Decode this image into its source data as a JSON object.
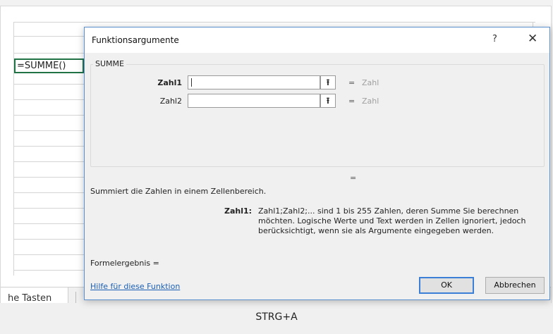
{
  "spreadsheet": {
    "active_cell_formula": "=SUMME()",
    "sheet_tab_label": "he Tasten"
  },
  "dialog": {
    "title": "Funktionsargumente",
    "help_button": "?",
    "close_button": "✕",
    "function_name": "SUMME",
    "arguments": [
      {
        "label": "Zahl1",
        "value": "",
        "type_hint": "Zahl",
        "bold": true
      },
      {
        "label": "Zahl2",
        "value": "",
        "type_hint": "Zahl",
        "bold": false
      }
    ],
    "equals_sign": "=",
    "function_result_equals": "=",
    "description": "Summiert die Zahlen in einem Zellenbereich.",
    "param_name": "Zahl1:",
    "param_description": "Zahl1;Zahl2;... sind 1 bis 255 Zahlen, deren Summe Sie berechnen möchten. Logische Werte und Text werden in Zellen ignoriert, jedoch berücksichtigt, wenn sie als Argumente eingegeben werden.",
    "formula_result_label": "Formelergebnis =",
    "help_link": "Hilfe für diese Funktion",
    "ok_button": "OK",
    "cancel_button": "Abbrechen",
    "ref_icon_glyph": "⭱"
  },
  "caption": "STRG+A"
}
